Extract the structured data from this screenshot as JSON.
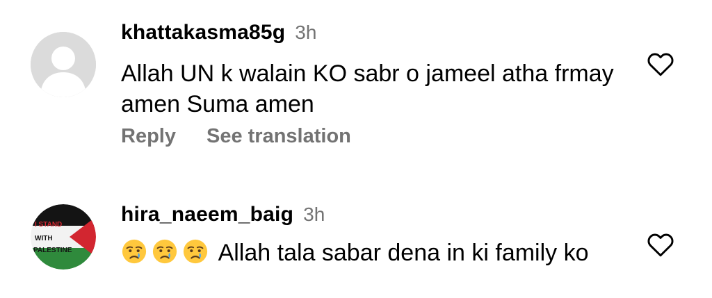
{
  "comments": [
    {
      "username": "khattakasma85g",
      "time": "3h",
      "text": "Allah UN k walain KO sabr o jameel atha frmay amen Suma amen",
      "reply_label": "Reply",
      "translate_label": "See translation",
      "avatar_icon": "default-profile-silhouette"
    },
    {
      "username": "hira_naeem_baig",
      "time": "3h",
      "emojis": [
        "crying-face",
        "crying-face",
        "crying-face"
      ],
      "text": "Allah tala sabar dena in ki family ko",
      "avatar_text": {
        "line1": "I STAND",
        "line2": "WITH",
        "line3": "PALESTINE"
      },
      "avatar_colors": {
        "black": "#141414",
        "white": "#f2f2f2",
        "green": "#2f8a3c",
        "red": "#d22630"
      }
    }
  ],
  "icons": {
    "like": "heart-outline-icon",
    "emoji": "crying-face-emoji"
  },
  "colors": {
    "secondary_text": "#737373",
    "avatar_placeholder": "#dbdbdb"
  }
}
